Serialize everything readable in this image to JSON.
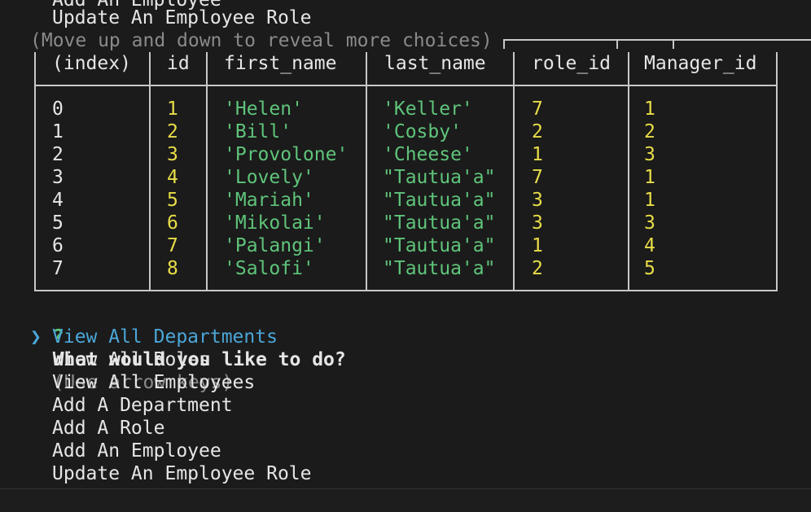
{
  "top_partial": {
    "line1": "Add An Employee",
    "line2": "Update An Employee Role",
    "hint": "(Move up and down to reveal more choices)"
  },
  "table": {
    "headers": [
      "(index)",
      "id",
      "first_name",
      "last_name",
      "role_id",
      "Manager_id"
    ],
    "rows": [
      [
        "0",
        "1",
        "'Helen'",
        "'Keller'",
        "7",
        "1"
      ],
      [
        "1",
        "2",
        "'Bill'",
        "'Cosby'",
        "2",
        "2"
      ],
      [
        "2",
        "3",
        "'Provolone'",
        "'Cheese'",
        "1",
        "3"
      ],
      [
        "3",
        "4",
        "'Lovely'",
        "\"Tautua'a\"",
        "7",
        "1"
      ],
      [
        "4",
        "5",
        "'Mariah'",
        "\"Tautua'a\"",
        "3",
        "1"
      ],
      [
        "5",
        "6",
        "'Mikolai'",
        "\"Tautua'a\"",
        "3",
        "3"
      ],
      [
        "6",
        "7",
        "'Palangi'",
        "\"Tautua'a\"",
        "1",
        "4"
      ],
      [
        "7",
        "8",
        "'Salofi'",
        "\"Tautua'a\"",
        "2",
        "5"
      ]
    ]
  },
  "prompt": {
    "mark": "?",
    "question": "What would you like to do?",
    "hint": "(Use arrow keys)",
    "pointer": "❯",
    "choices": [
      "View All Departments",
      "View All Roles",
      "View All Employees",
      "Add A Department",
      "Add A Role",
      "Add An Employee",
      "Update An Employee Role"
    ]
  },
  "colors": {
    "background": "#1b1b1b",
    "string": "#5fc47a",
    "number": "#e8dd48",
    "selected": "#4aa6d8",
    "prompt_mark": "#5fc47a",
    "dim": "#8a8a8a"
  }
}
